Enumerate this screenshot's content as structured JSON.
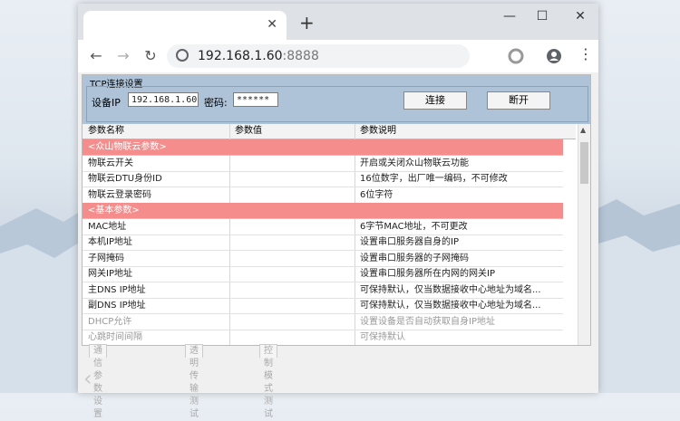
{
  "browser": {
    "url_host": "192.168.1.60",
    "url_port": ":8888",
    "new_tab": "+"
  },
  "tcp": {
    "title": "TCP连接设置",
    "device_ip_label": "设备IP",
    "device_ip_value": "192.168.1.60",
    "password_label": "密码:",
    "password_value": "******",
    "connect_label": "连接",
    "disconnect_label": "断开"
  },
  "table": {
    "headers": [
      "参数名称",
      "参数值",
      "参数说明"
    ],
    "rows": [
      {
        "name": "<众山物联云参数>",
        "value": "",
        "desc": "",
        "type": "group"
      },
      {
        "name": "物联云开关",
        "value": "",
        "desc": "开启或关闭众山物联云功能",
        "type": "normal"
      },
      {
        "name": "物联云DTU身份ID",
        "value": "",
        "desc": "16位数字，出厂唯一编码，不可修改",
        "type": "normal"
      },
      {
        "name": "物联云登录密码",
        "value": "",
        "desc": "6位字符",
        "type": "normal"
      },
      {
        "name": "<基本参数>",
        "value": "",
        "desc": "",
        "type": "group"
      },
      {
        "name": "MAC地址",
        "value": "",
        "desc": "6字节MAC地址，不可更改",
        "type": "normal"
      },
      {
        "name": "本机IP地址",
        "value": "",
        "desc": "设置串口服务器自身的IP",
        "type": "normal"
      },
      {
        "name": "子网掩码",
        "value": "",
        "desc": "设置串口服务器的子网掩码",
        "type": "normal"
      },
      {
        "name": "网关IP地址",
        "value": "",
        "desc": "设置串口服务器所在内网的网关IP",
        "type": "normal"
      },
      {
        "name": "主DNS IP地址",
        "value": "",
        "desc": "可保持默认，仅当数据接收中心地址为域名...",
        "type": "normal"
      },
      {
        "name": "副DNS IP地址",
        "value": "",
        "desc": "可保持默认，仅当数据接收中心地址为域名...",
        "type": "normal"
      },
      {
        "name": "DHCP允许",
        "value": "",
        "desc": "设置设备是否自动获取自身IP地址",
        "type": "dim"
      },
      {
        "name": "心跳时间间隔",
        "value": "",
        "desc": "可保持默认",
        "type": "dim"
      }
    ]
  },
  "bottom_tabs": [
    "通信参数设置",
    "透明传输测试",
    "控制模式测试"
  ],
  "colors": {
    "group_row": "#f58d8d",
    "tcp_panel": "#aec3d8"
  }
}
